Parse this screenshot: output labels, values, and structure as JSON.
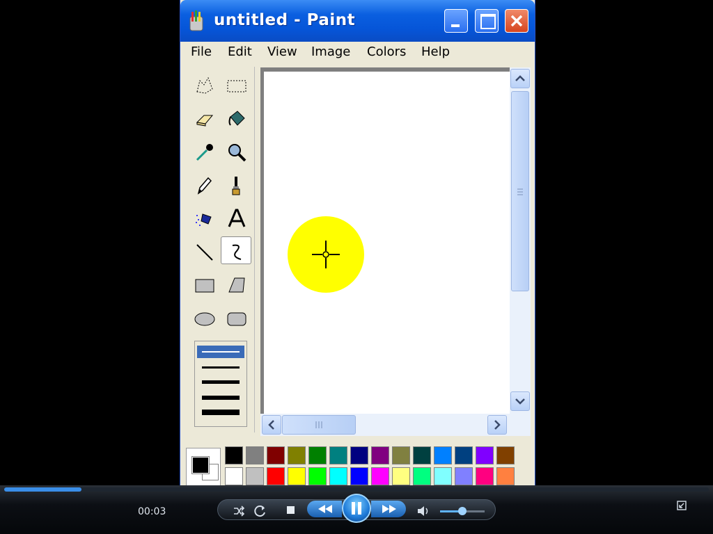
{
  "window": {
    "title": "untitled - Paint",
    "menu": [
      "File",
      "Edit",
      "View",
      "Image",
      "Colors",
      "Help"
    ]
  },
  "toolbox": {
    "tools": [
      "free-form-select-icon",
      "rect-select-icon",
      "eraser-icon",
      "fill-bucket-icon",
      "pick-color-icon",
      "magnifier-icon",
      "pencil-icon",
      "brush-icon",
      "airbrush-icon",
      "text-icon",
      "line-icon",
      "curve-icon",
      "rectangle-icon",
      "polygon-icon",
      "ellipse-icon",
      "rounded-rect-icon"
    ],
    "selected_tool": "curve-icon",
    "line_widths": 5,
    "selected_width": 1
  },
  "canvas": {
    "cursor": "crosshair",
    "highlight_color": "#ffff00"
  },
  "palette": {
    "foreground": "#000000",
    "background": "#ffffff",
    "top_row": [
      "#000000",
      "#808080",
      "#800000",
      "#808000",
      "#008000",
      "#008080",
      "#000080",
      "#800080",
      "#808040",
      "#004040",
      "#0080ff",
      "#004080",
      "#8000ff",
      "#804000"
    ],
    "bottom_row": [
      "#ffffff",
      "#c0c0c0",
      "#ff0000",
      "#ffff00",
      "#00ff00",
      "#00ffff",
      "#0000ff",
      "#ff00ff",
      "#ffff80",
      "#00ff80",
      "#80ffff",
      "#8080ff",
      "#ff0080",
      "#ff8040"
    ]
  },
  "player": {
    "time": "00:03",
    "progress": 0.11,
    "volume": 0.5,
    "controls": [
      "shuffle-icon",
      "repeat-icon",
      "stop-icon",
      "rewind-icon",
      "pause-icon",
      "fast-forward-icon",
      "volume-icon"
    ],
    "corner_icon": "switch-to-compact-icon"
  }
}
